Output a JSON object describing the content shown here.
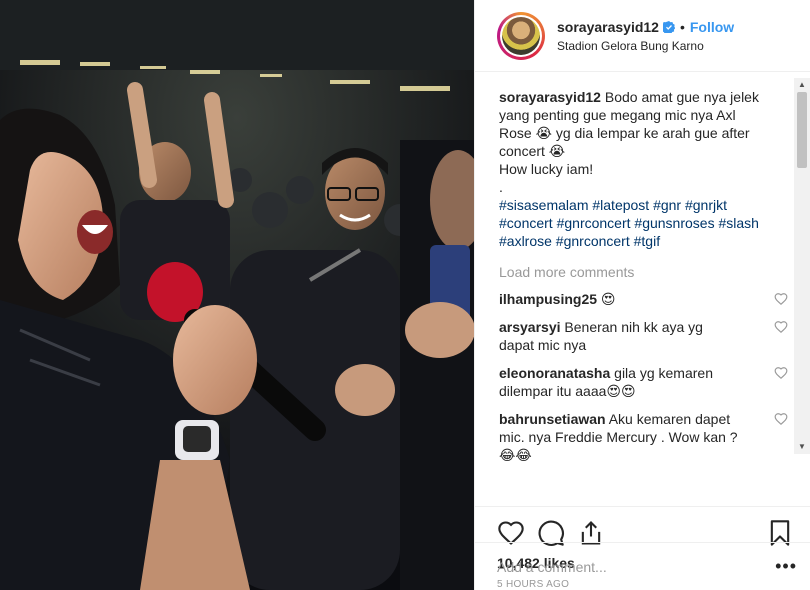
{
  "header": {
    "username": "sorayarasyid12",
    "separator": "•",
    "follow_label": "Follow",
    "location": "Stadion Gelora Bung Karno",
    "verified_icon": "verified-badge-icon"
  },
  "caption": {
    "username": "sorayarasyid12",
    "line1": "Bodo amat gue nya jelek yang penting gue megang mic nya Axl Rose 😭 yg dia lempar ke arah gue after concert 😭",
    "line2": "How lucky iam!",
    "line3": ".",
    "hashtags": "#sisasemalam #latepost #gnr #gnrjkt #concert #gnrconcert #gunsnroses #slash #axlrose #gnrconcert #tgif"
  },
  "load_more_label": "Load more comments",
  "comments": [
    {
      "username": "ilhampusing25",
      "text": "😍"
    },
    {
      "username": "arsyarsyi",
      "text": "Beneran nih kk aya yg dapat mic nya"
    },
    {
      "username": "eleonoranatasha",
      "text": "gila yg kemaren dilempar itu aaaa😍😍"
    },
    {
      "username": "bahrunsetiawan",
      "text": "Aku kemaren dapet mic. nya Freddie Mercury . Wow kan ? 😂😂"
    }
  ],
  "actions": {
    "likes": "10,482 likes",
    "time_ago": "5 HOURS AGO",
    "icons": [
      "heart-icon",
      "comment-icon",
      "share-icon",
      "bookmark-icon"
    ]
  },
  "add_comment": {
    "placeholder": "Add a comment...",
    "more": "•••"
  },
  "colors": {
    "link": "#3897f0",
    "hashtag": "#003569",
    "muted": "#999999",
    "text": "#262626"
  }
}
